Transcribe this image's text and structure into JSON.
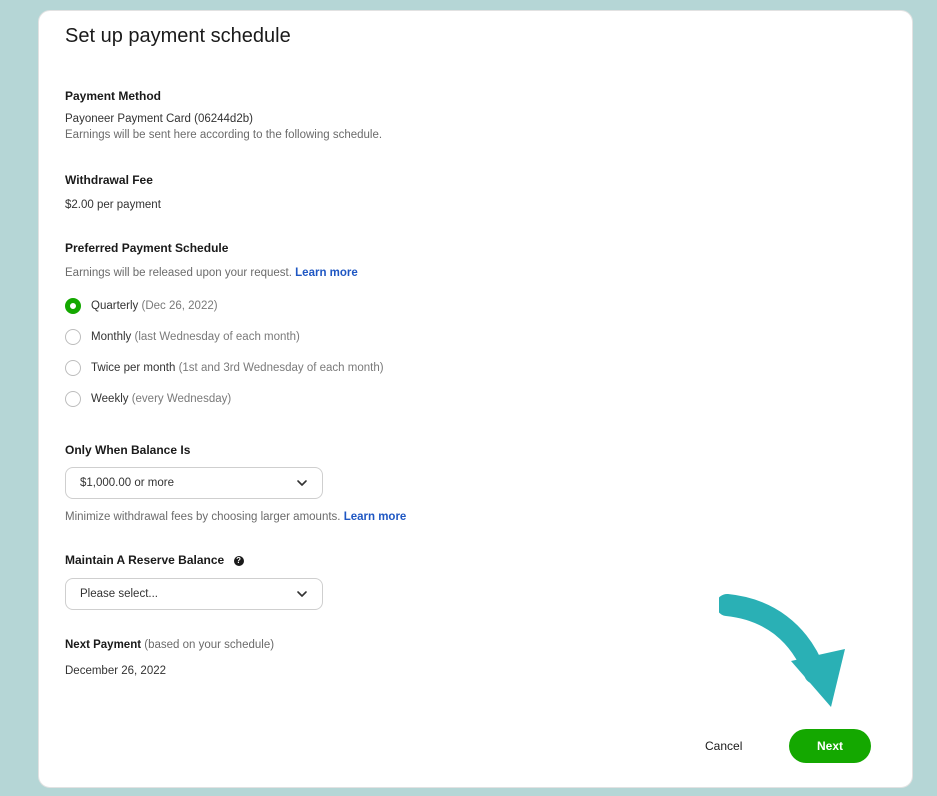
{
  "title": "Set up payment schedule",
  "payment_method": {
    "label": "Payment Method",
    "value": "Payoneer Payment Card (06244d2b)",
    "note": "Earnings will be sent here according to the following schedule."
  },
  "withdrawal_fee": {
    "label": "Withdrawal Fee",
    "value": "$2.00 per payment"
  },
  "schedule": {
    "label": "Preferred Payment Schedule",
    "note": "Earnings will be released upon your request.",
    "learn_more": "Learn more",
    "options": [
      {
        "name": "Quarterly",
        "detail": "(Dec 26, 2022)",
        "checked": true
      },
      {
        "name": "Monthly",
        "detail": "(last Wednesday of each month)",
        "checked": false
      },
      {
        "name": "Twice per month",
        "detail": "(1st and 3rd Wednesday of each month)",
        "checked": false
      },
      {
        "name": "Weekly",
        "detail": "(every Wednesday)",
        "checked": false
      }
    ]
  },
  "balance": {
    "label": "Only When Balance Is",
    "selected": "$1,000.00 or more",
    "note": "Minimize withdrawal fees by choosing larger amounts.",
    "learn_more": "Learn more"
  },
  "reserve": {
    "label": "Maintain A Reserve Balance",
    "info_icon_glyph": "?",
    "placeholder": "Please select..."
  },
  "next_payment": {
    "label": "Next Payment",
    "label_suffix": "(based on your schedule)",
    "value": "December 26, 2022"
  },
  "actions": {
    "cancel": "Cancel",
    "next": "Next"
  },
  "colors": {
    "accent": "#14a800",
    "link": "#1f57c3",
    "arrow": "#2ab0b5",
    "frame": "#b5d6d6"
  },
  "icons": [
    "chevron-down-icon",
    "info-icon",
    "radio-icon",
    "arrow-pointer-icon"
  ]
}
